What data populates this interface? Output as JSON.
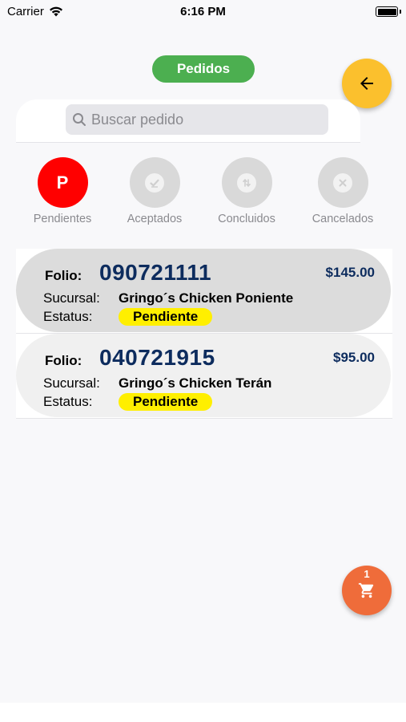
{
  "status_bar": {
    "carrier": "Carrier",
    "time": "6:16 PM"
  },
  "header": {
    "title": "Pedidos"
  },
  "search": {
    "placeholder": "Buscar pedido"
  },
  "filters": [
    {
      "label": "Pendientes",
      "letter": "P",
      "active": true
    },
    {
      "label": "Aceptados",
      "active": false
    },
    {
      "label": "Concluidos",
      "active": false
    },
    {
      "label": "Cancelados",
      "active": false
    }
  ],
  "orders": [
    {
      "folio_label": "Folio:",
      "folio": "090721111",
      "price": "$145.00",
      "sucursal_label": "Sucursal:",
      "sucursal": "Gringo´s Chicken Poniente",
      "estatus_label": "Estatus:",
      "estatus": "Pendiente"
    },
    {
      "folio_label": "Folio:",
      "folio": "040721915",
      "price": "$95.00",
      "sucursal_label": "Sucursal:",
      "sucursal": "Gringo´s Chicken Terán",
      "estatus_label": "Estatus:",
      "estatus": "Pendiente"
    }
  ],
  "cart": {
    "count": "1"
  },
  "colors": {
    "accent_green": "#4caf50",
    "back_yellow": "#fbc02d",
    "active_red": "#ff0000",
    "cart_orange": "#ef6c3a",
    "badge_yellow": "#ffef00",
    "folio_blue": "#0d2c5e"
  },
  "icons": {
    "back": "arrow-left-icon",
    "search": "search-icon",
    "cart": "shopping-cart-icon"
  }
}
